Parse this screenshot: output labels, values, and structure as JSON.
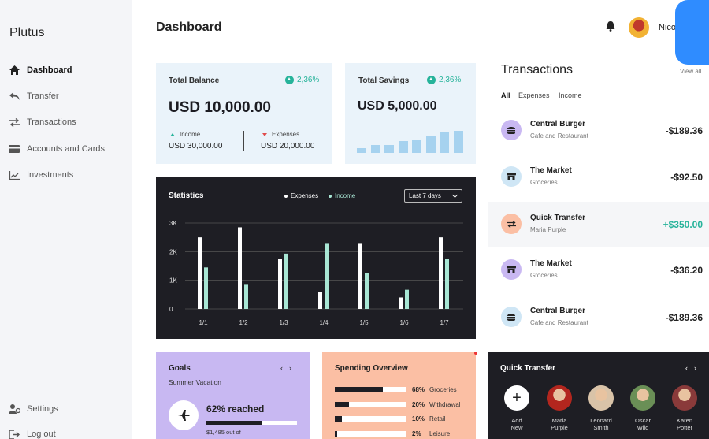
{
  "app": {
    "brand": "Plutus"
  },
  "sidebar": {
    "items": [
      {
        "label": "Dashboard",
        "icon": "home-icon",
        "active": true
      },
      {
        "label": "Transfer",
        "icon": "reply-arrow-icon"
      },
      {
        "label": "Transactions",
        "icon": "swap-arrows-icon"
      },
      {
        "label": "Accounts and Cards",
        "icon": "credit-card-icon"
      },
      {
        "label": "Investments",
        "icon": "trend-chart-icon"
      }
    ],
    "bottom": [
      {
        "label": "Settings",
        "icon": "user-gear-icon"
      },
      {
        "label": "Log out",
        "icon": "logout-icon"
      }
    ]
  },
  "header": {
    "title": "Dashboard",
    "user_name": "Nico"
  },
  "balance": {
    "label": "Total Balance",
    "change": "2,36%",
    "amount": "USD 10,000.00",
    "income_label": "Income",
    "income_value": "USD 30,000.00",
    "expenses_label": "Expenses",
    "expenses_value": "USD 20,000.00"
  },
  "savings": {
    "label": "Total Savings",
    "change": "2,36%",
    "amount": "USD 5,000.00",
    "bars": [
      0.2,
      0.35,
      0.35,
      0.55,
      0.6,
      0.75,
      0.95,
      1.0
    ]
  },
  "statistics": {
    "title": "Statistics",
    "legend_expenses": "Expenses",
    "legend_income": "Income",
    "range": "Last 7 days"
  },
  "chart_data": {
    "type": "bar",
    "categories": [
      "1/1",
      "1/2",
      "1/3",
      "1/4",
      "1/5",
      "1/6",
      "1/7"
    ],
    "series": [
      {
        "name": "Expenses",
        "values": [
          2500,
          2850,
          1750,
          600,
          2300,
          400,
          2500
        ]
      },
      {
        "name": "Income",
        "values": [
          1450,
          870,
          1930,
          2300,
          1250,
          670,
          1740
        ]
      }
    ],
    "ylim": [
      0,
      3000
    ],
    "yticks": [
      "0",
      "1K",
      "2K",
      "3K"
    ],
    "colors": {
      "Expenses": "#ffffff",
      "Income": "#a8e6d4"
    },
    "grid": true
  },
  "transactions": {
    "title": "Transactions",
    "view_all": "View all",
    "filters": [
      "All",
      "Expenses",
      "Income"
    ],
    "items": [
      {
        "name": "Central Burger",
        "category": "Cafe and Restaurant",
        "amount": "-$189.36",
        "icon": "burger-icon",
        "icon_bg": "#c9b8f2"
      },
      {
        "name": "The Market",
        "category": "Groceries",
        "amount": "-$92.50",
        "icon": "store-icon",
        "icon_bg": "#cfe6f5"
      },
      {
        "name": "Quick Transfer",
        "category": "Maria Purple",
        "amount": "+$350.00",
        "icon": "swap-arrows-icon",
        "icon_bg": "#fbbfa4",
        "positive": true
      },
      {
        "name": "The Market",
        "category": "Groceries",
        "amount": "-$36.20",
        "icon": "store-icon",
        "icon_bg": "#c9b8f2"
      },
      {
        "name": "Central Burger",
        "category": "Cafe and Restaurant",
        "amount": "-$189.36",
        "icon": "burger-icon",
        "icon_bg": "#cfe6f5"
      }
    ]
  },
  "goals": {
    "title": "Goals",
    "subtitle": "Summer Vacation",
    "reached": "62% reached",
    "progress": 0.62,
    "amount_text": "$1,485 out of"
  },
  "spending": {
    "title": "Spending Overview",
    "items": [
      {
        "pct": "68%",
        "label": "Groceries",
        "value": 0.68
      },
      {
        "pct": "20%",
        "label": "Withdrawal",
        "value": 0.2
      },
      {
        "pct": "10%",
        "label": "Retail",
        "value": 0.1
      },
      {
        "pct": "2%",
        "label": "Leisure",
        "value": 0.02
      }
    ]
  },
  "quick_transfer": {
    "title": "Quick Transfer",
    "add_label_1": "Add",
    "add_label_2": "New",
    "people": [
      {
        "first": "Maria",
        "last": "Purple",
        "color": "#b3261e"
      },
      {
        "first": "Leonard",
        "last": "Smith",
        "color": "#d9c3a8"
      },
      {
        "first": "Oscar",
        "last": "Wild",
        "color": "#6a8f56"
      },
      {
        "first": "Karen",
        "last": "Potter",
        "color": "#8a3a3a"
      }
    ]
  }
}
